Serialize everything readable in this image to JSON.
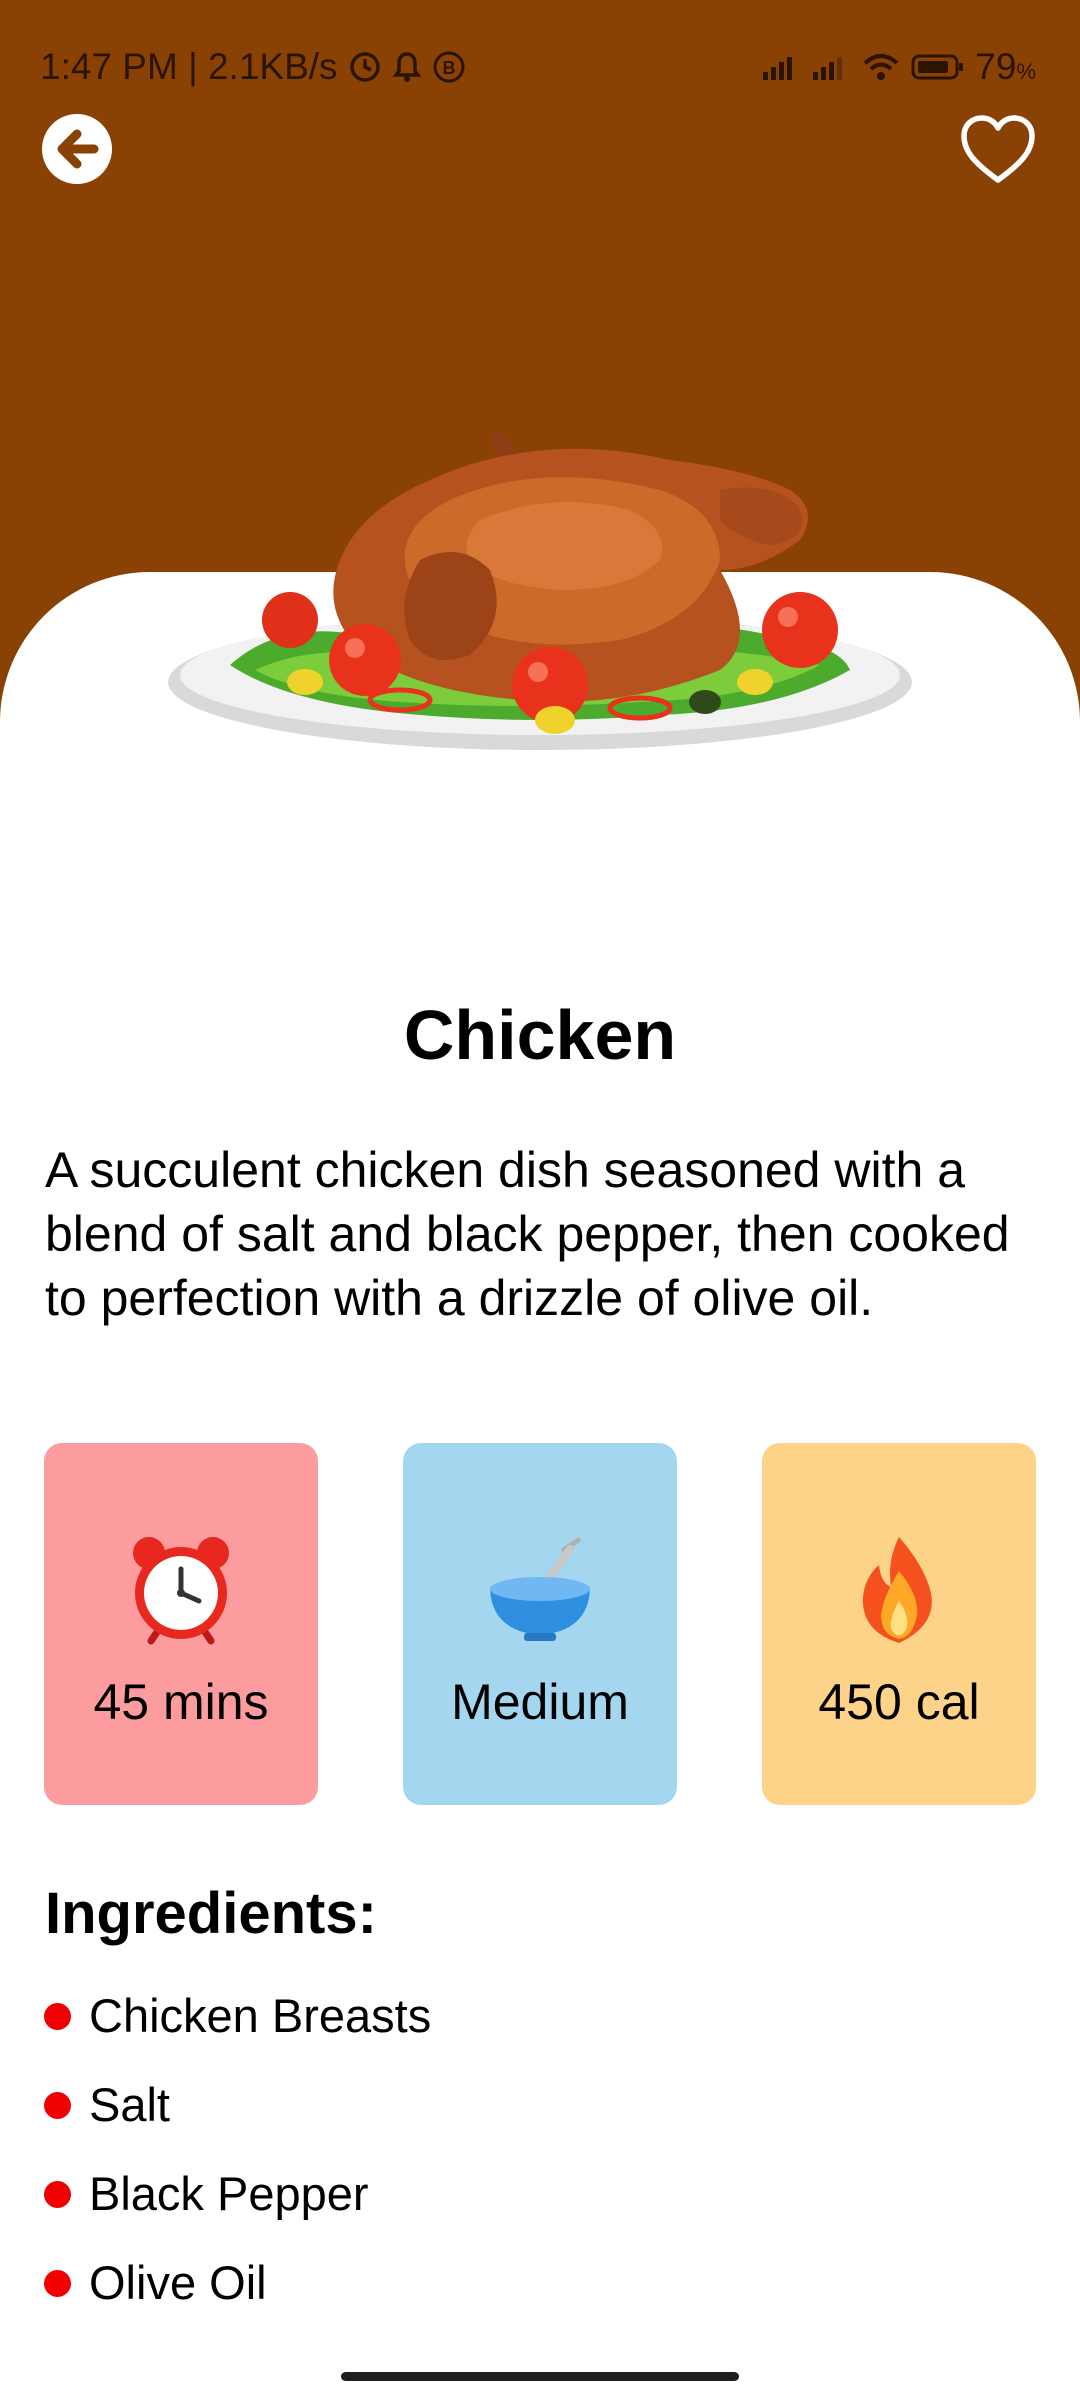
{
  "status": {
    "time_speed": "1:47 PM | 2.1KB/s",
    "battery": "79",
    "battery_unit": "%"
  },
  "header": {
    "back_icon": "arrow-left-icon",
    "favorite_icon": "heart-outline-icon"
  },
  "recipe": {
    "title": "Chicken",
    "description": "A succulent chicken dish seasoned with a blend of salt and black pepper, then cooked to perfection with a drizzle of olive oil.",
    "stats": [
      {
        "icon": "alarm-clock-icon",
        "label": "45 mins",
        "color": "#fc9c9f"
      },
      {
        "icon": "mixing-bowl-icon",
        "label": "Medium",
        "color": "#a4d6ef"
      },
      {
        "icon": "fire-icon",
        "label": "450 cal",
        "color": "#fdd389"
      }
    ],
    "ingredients_title": "Ingredients:",
    "ingredients": [
      "Chicken Breasts",
      "Salt",
      "Black Pepper",
      "Olive Oil"
    ]
  },
  "colors": {
    "header_bg": "#8a4204",
    "bullet": "#f00000"
  }
}
